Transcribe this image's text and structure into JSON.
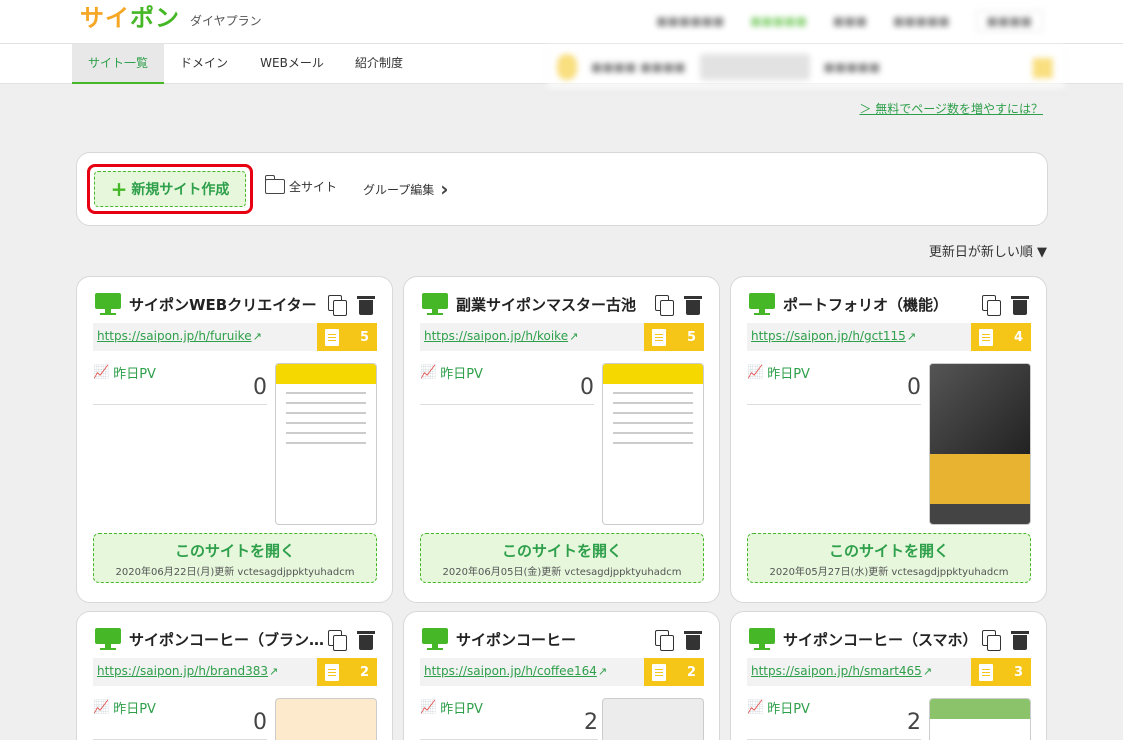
{
  "header": {
    "logo": [
      "サ",
      "イ",
      "ポ",
      "ン"
    ],
    "plan": "ダイヤプラン"
  },
  "nav": {
    "items": [
      "サイト一覧",
      "ドメイン",
      "WEBメール",
      "紹介制度"
    ],
    "active_index": 0
  },
  "free_link": "＞ 無料でページ数を増やすには？",
  "toolbar": {
    "new_site": "新規サイト作成",
    "all_sites": "全サイト",
    "group_edit": "グループ編集"
  },
  "sort": {
    "label": "更新日が新しい順 ▼"
  },
  "pv_label": "昨日PV",
  "open_label": "このサイトを開く",
  "cards": [
    {
      "title": "サイポンWEBクリエイター",
      "url": "https://saipon.jp/h/furuike",
      "pages": "5",
      "pv": "0",
      "meta": "2020年06月22日(月)更新 vctesagdjppktyuhadcm"
    },
    {
      "title": "副業サイポンマスター古池",
      "url": "https://saipon.jp/h/koike",
      "pages": "5",
      "pv": "0",
      "meta": "2020年06月05日(金)更新 vctesagdjppktyuhadcm"
    },
    {
      "title": "ポートフォリオ（機能）",
      "url": "https://saipon.jp/h/gct115",
      "pages": "4",
      "pv": "0",
      "meta": "2020年05月27日(水)更新 vctesagdjppktyuhadcm"
    },
    {
      "title": "サイポンコーヒー（ブランド）",
      "url": "https://saipon.jp/h/brand383",
      "pages": "2",
      "pv": "0",
      "meta": ""
    },
    {
      "title": "サイポンコーヒー",
      "url": "https://saipon.jp/h/coffee164",
      "pages": "2",
      "pv": "2",
      "meta": ""
    },
    {
      "title": "サイポンコーヒー（スマホ）",
      "url": "https://saipon.jp/h/smart465",
      "pages": "3",
      "pv": "2",
      "meta": ""
    }
  ],
  "colors": {
    "brand_green": "#46b827",
    "link_green": "#2e9f4a",
    "badge_yellow": "#f5c518",
    "highlight_red": "#e60012"
  }
}
